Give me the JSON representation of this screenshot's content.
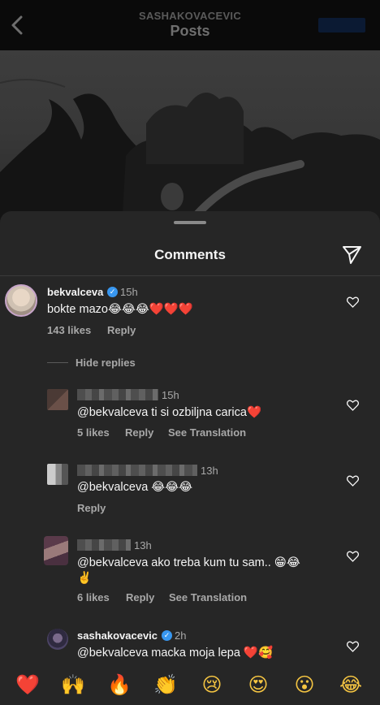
{
  "nav": {
    "username": "SASHAKOVACEVIC",
    "title": "Posts"
  },
  "sheet": {
    "title": "Comments"
  },
  "comment": {
    "username": "bekvalceva",
    "time": "15h",
    "text": "bokte mazo😂😂😂❤️❤️❤️",
    "likes": "143 likes",
    "reply": "Reply"
  },
  "hide_replies": "Hide replies",
  "replies": [
    {
      "time": "15h",
      "text": "@bekvalceva ti si ozbiljna carica❤️",
      "likes": "5 likes",
      "reply": "Reply",
      "translate": "See Translation"
    },
    {
      "time": "13h",
      "text": "@bekvalceva 😂😂😂",
      "reply": "Reply"
    },
    {
      "time": "13h",
      "text": "@bekvalceva ako treba kum tu sam.. 😁😂",
      "text2": "✌️",
      "likes": "6 likes",
      "reply": "Reply",
      "translate": "See Translation"
    },
    {
      "username": "sashakovacevic",
      "time": "2h",
      "text": "@bekvalceva macka moja lepa ❤️🥰"
    }
  ],
  "quick_emojis": [
    "❤️",
    "🙌",
    "🔥",
    "👏",
    "😢",
    "😍",
    "😮",
    "😂"
  ],
  "colors": {
    "sheet_bg": "#262626",
    "verified": "#3897f0",
    "secondary_text": "#a8a8a8"
  }
}
